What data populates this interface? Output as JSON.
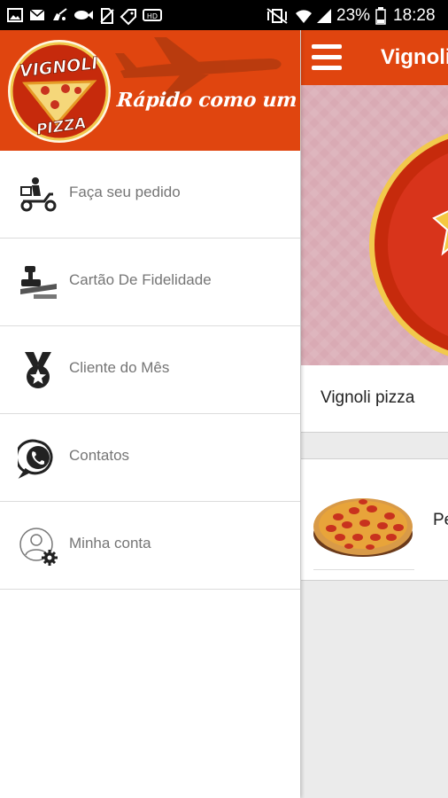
{
  "status_bar": {
    "battery_percent": "23%",
    "time": "18:28"
  },
  "brand": {
    "logo_top": "VIGNOLI",
    "logo_bottom": "PIZZA",
    "slogan": "Rápido como um avião!",
    "primary_color": "#e0450f"
  },
  "drawer": {
    "items": [
      {
        "label": "Faça seu pedido",
        "icon": "delivery-scooter-icon"
      },
      {
        "label": "Cartão De Fidelidade",
        "icon": "loyalty-stamp-icon"
      },
      {
        "label": "Cliente do Mês",
        "icon": "medal-icon"
      },
      {
        "label": "Contatos",
        "icon": "whatsapp-icon"
      },
      {
        "label": "Minha conta",
        "icon": "user-settings-icon"
      }
    ]
  },
  "app": {
    "title": "Vignoli",
    "store_name": "Vignoli pizza",
    "product_name": "Pe"
  }
}
